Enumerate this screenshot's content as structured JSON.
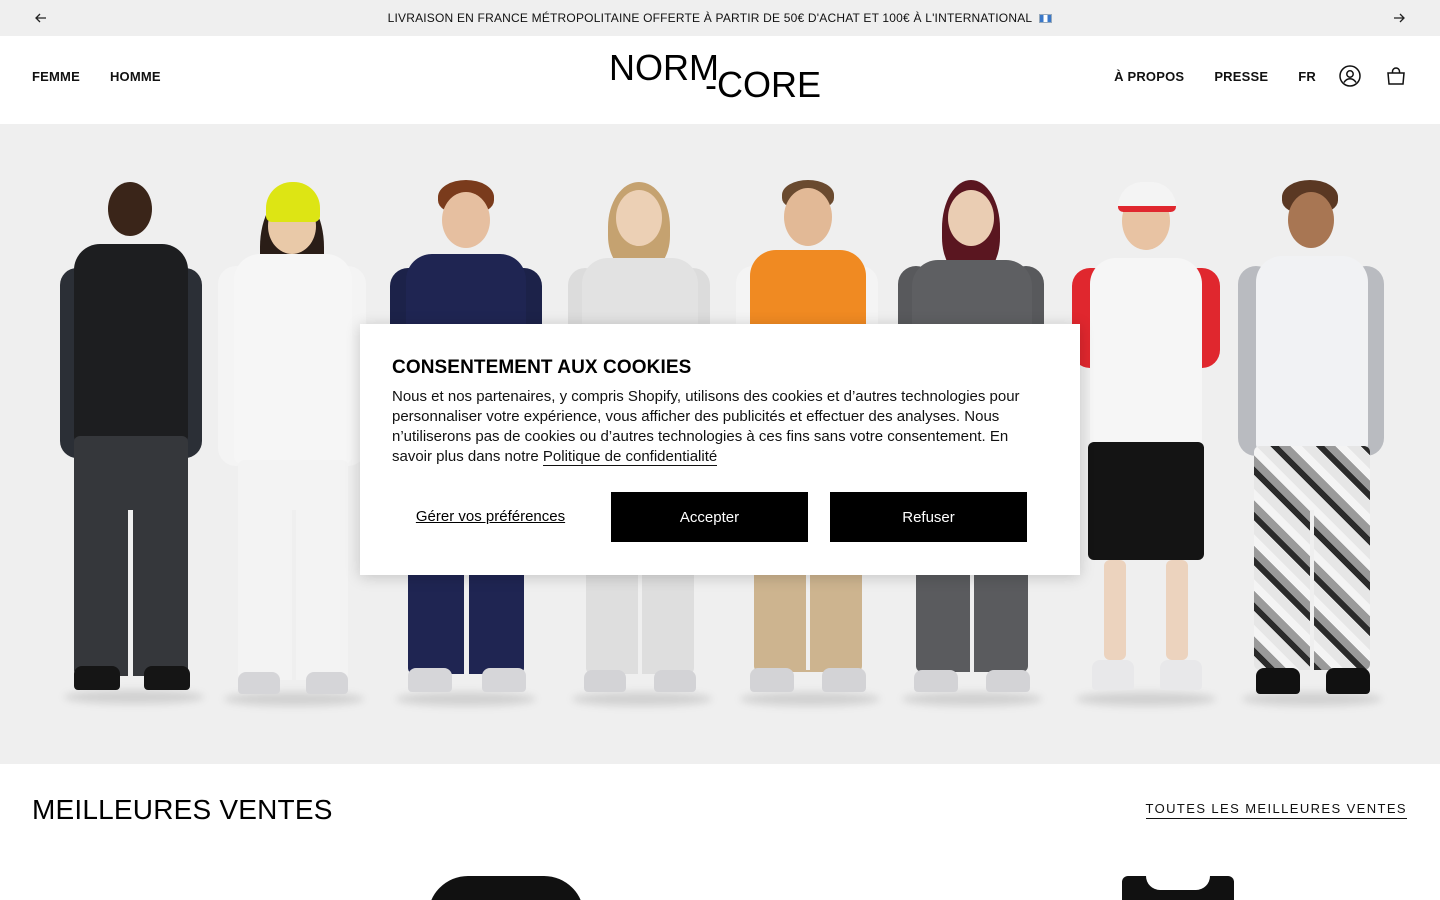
{
  "announcement": {
    "text": "LIVRAISON EN FRANCE MÉTROPOLITAINE OFFERTE À PARTIR DE 50€ D'ACHAT ET 100€ À L'INTERNATIONAL",
    "flag_icon": "flag-icon"
  },
  "nav": {
    "left": [
      "FEMME",
      "HOMME"
    ],
    "right": [
      "À PROPOS",
      "PRESSE",
      "FR"
    ],
    "account_icon": "account-icon",
    "cart_icon": "bag-icon"
  },
  "logo": {
    "line1": "NORM",
    "line2": "-CORE"
  },
  "cookie": {
    "title": "CONSENTEMENT AUX COOKIES",
    "body": "Nous et nos partenaires, y compris Shopify, utilisons des cookies et d’autres technologies pour personnaliser votre expérience, vous afficher des publicités et effectuer des analyses. Nous n’utiliserons pas de cookies ou d’autres technologies à ces fins sans votre consentement. En savoir plus dans notre",
    "policy_link": "Politique de confidentialité",
    "preferences_label": "Gérer vos préférences",
    "accept_label": "Accepter",
    "refuse_label": "Refuser"
  },
  "bestsellers": {
    "title": "MEILLEURES VENTES",
    "link": "TOUTES LES MEILLEURES VENTES"
  },
  "colors": {
    "announce_bg": "#efefef",
    "hero_bg": "#efefef",
    "button_black": "#000000"
  }
}
